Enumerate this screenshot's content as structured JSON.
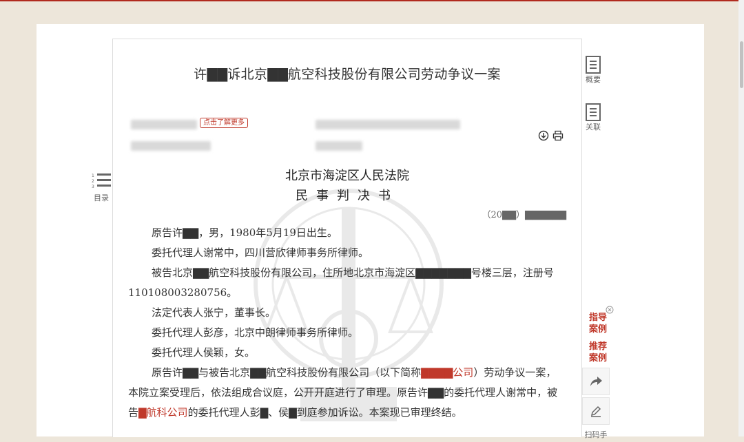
{
  "doc_title": "许▇▇诉北京▇▇航空科技股份有限公司劳动争议一案",
  "badge": "点击了解更多",
  "court": "北京市海淀区人民法院",
  "doctype": "民事判决书",
  "case_no": "（20▇▇）▇▇▇▇▇▇",
  "paragraphs": [
    "原告许▇▇，男，1980年5月19日出生。",
    "委托代理人谢常中，四川营欣律师事务所律师。",
    "被告北京▇▇航空科技股份有限公司，住所地北京市海淀区▇▇▇▇▇▇▇号楼三层，注册号110108003280756。",
    "法定代表人张宁，董事长。",
    "委托代理人彭彦，北京中朗律师事务所律师。",
    "委托代理人侯颖，女。"
  ],
  "last_para": {
    "p1": "原告许▇▇与被告北京▇▇航空科技股份有限公司（以下简称",
    "r1": "▇▇▇▇公司",
    "p2": "）劳动争议一案，本院立案受理后，依法组成合议庭，公开开庭进行了审理。原告许▇▇的委托代理人谢常中，被告",
    "r2": "▇航科公司",
    "p3": "的委托代理人彭▇、侯▇到庭参加诉讼。本案现已审理终结。"
  },
  "sidebar_left": {
    "catalog": "目录"
  },
  "sidebar_right": {
    "overview": "概要",
    "related": "关联",
    "guide": "指导\n案例",
    "recommend": "推荐\n案例",
    "share_hint": "扫码手"
  },
  "icons": [
    "download-icon",
    "print-icon",
    "share-icon",
    "edit-icon",
    "close-icon",
    "list-icon"
  ],
  "colors": {
    "accent": "#c0392b",
    "background": "#ede6da"
  }
}
